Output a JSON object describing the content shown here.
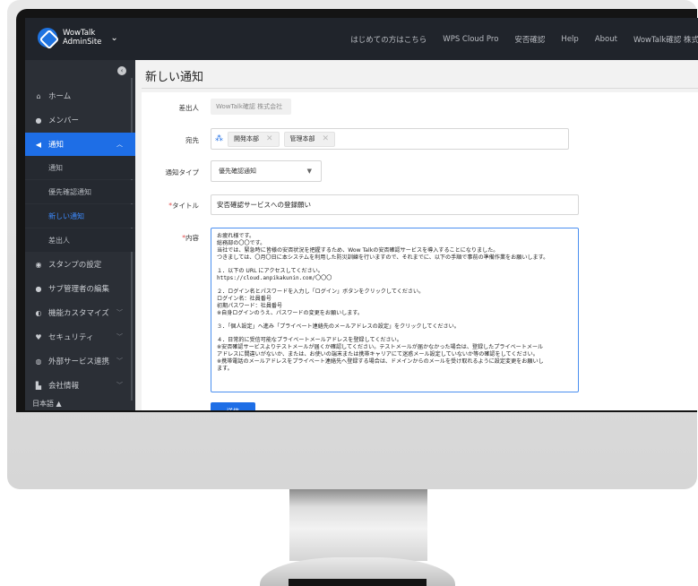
{
  "brand": {
    "name": "WowTalk",
    "sub": "AdminSite"
  },
  "topnav": [
    "はじめての方はこちら",
    "WPS Cloud Pro",
    "安否確認",
    "Help",
    "About",
    "WowTalk確認 株式"
  ],
  "sidebar": {
    "items": [
      {
        "label": "ホーム",
        "icon": "home-icon"
      },
      {
        "label": "メンバー",
        "icon": "user-icon"
      },
      {
        "label": "通知",
        "icon": "megaphone-icon",
        "active": true
      },
      {
        "label": "スタンプの設定",
        "icon": "sticker-icon"
      },
      {
        "label": "サブ管理者の編集",
        "icon": "admin-icon"
      },
      {
        "label": "機能カスタマイズ",
        "icon": "toggle-icon"
      },
      {
        "label": "セキュリティ",
        "icon": "shield-icon"
      },
      {
        "label": "外部サービス連携",
        "icon": "link-icon"
      },
      {
        "label": "会社情報",
        "icon": "building-icon"
      }
    ],
    "sub_items": [
      "通知",
      "優先確認通知",
      "新しい通知",
      "差出人"
    ],
    "language": "日本語 ▲"
  },
  "page": {
    "title": "新しい通知"
  },
  "form": {
    "sender_label": "差出人",
    "sender_value": "WowTalk確認 株式会社",
    "recipient_label": "宛先",
    "recipients": [
      "開発本部",
      "管理本部"
    ],
    "type_label": "通知タイプ",
    "type_value": "優先確認通知",
    "title_label": "タイトル",
    "title_value": "安否確認サービスへの登録願い",
    "body_label": "内容",
    "body_lines": [
      "お疲れ様です。",
      "総務部の〇〇です。",
      "当社では、緊急時に皆様の安否状況を把握するため、Wow Talkの安否確認サービスを導入することになりました。",
      "つきましては、〇月〇日に本システムを利用した防災訓練を行いますので、それまでに、以下の手順で事前の準備作業をお願いします。",
      "",
      "１．以下の URL にアクセスしてください。",
      "https://cloud.anpikakunin.com/〇〇〇",
      "",
      "２．ログイン名とパスワードを入力し「ログイン」ボタンをクリックしてください。",
      "ログイン名：社員番号",
      "初期パスワード：社員番号",
      "※自身ログインのうえ、パスワードの変更をお願いします。",
      "",
      "３．「個人設定」へ進み「プライベート連絡先のメールアドレスの設定」をクリックしてください。",
      "",
      "４．日常的に受信可能なプライベートメールアドレスを登録してください。",
      "※安否確認サービスよりテストメールが届くか確認してください。テストメールが届かなかった場合は、登録したプライベートメール",
      "アドレスに間違いがないか、または、お使いの端末または携帯キャリアにて迷惑メール設定していないか等の確認をしてください。",
      "※携帯電話のメールアドレスをプライベート連絡先へ登録する場合は、ドメインからのメールを受け取れるように設定変更をお願いし",
      "ます。"
    ],
    "send_label": "送信"
  }
}
